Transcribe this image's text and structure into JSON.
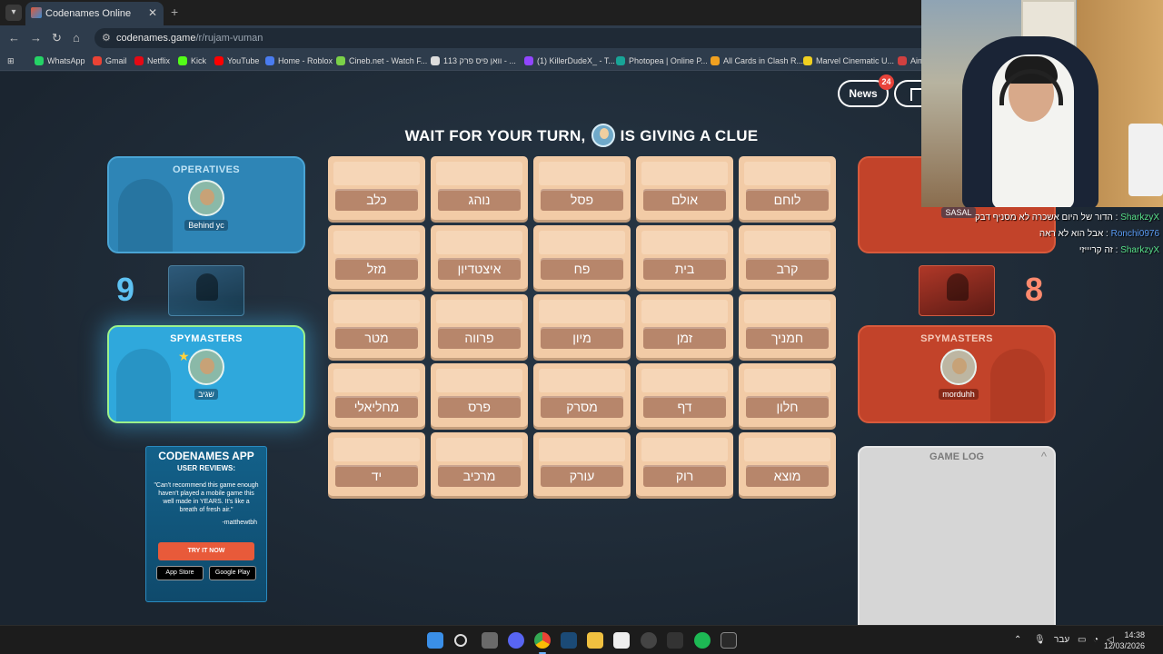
{
  "browser": {
    "tab_title": "Codenames Online",
    "tab_close": "✕",
    "new_tab": "+",
    "url_host": "codenames.game",
    "url_path": "/r/rujam-vuman"
  },
  "bookmarks": [
    {
      "label": "WhatsApp",
      "color": "#25d366"
    },
    {
      "label": "Gmail",
      "color": "#ea4335"
    },
    {
      "label": "Netflix",
      "color": "#e50914"
    },
    {
      "label": "Kick",
      "color": "#53fc18"
    },
    {
      "label": "YouTube",
      "color": "#ff0000"
    },
    {
      "label": "Home - Roblox",
      "color": "#4a7cf0"
    },
    {
      "label": "Cineb.net - Watch F...",
      "color": "#7bd148"
    },
    {
      "label": "וואן פיס פרק 113 - ...",
      "color": "#dddddd"
    },
    {
      "label": "(1) KillerDudeX_ - T...",
      "color": "#9146ff"
    },
    {
      "label": "Photopea | Online P...",
      "color": "#18a497"
    },
    {
      "label": "All Cards in Clash R...",
      "color": "#f0a020"
    },
    {
      "label": "Marvel Cinematic U...",
      "color": "#f0d020"
    },
    {
      "label": "Aim",
      "color": "#d04040"
    }
  ],
  "header": {
    "news_label": "News",
    "news_badge": "24"
  },
  "status": {
    "before": "WAIT FOR YOUR TURN,",
    "after": "IS GIVING A CLUE"
  },
  "blue_team": {
    "operatives_title": "OPERATIVES",
    "operative_name": "Behind yc",
    "score": "9",
    "spymasters_title": "SPYMASTERS",
    "spymaster_name": "שגיב",
    "color": "#2fa8dc"
  },
  "red_team": {
    "operatives_name": "SASAL",
    "score": "8",
    "spymasters_title": "SPYMASTERS",
    "spymaster_name": "morduhh",
    "color": "#c2432a"
  },
  "board": {
    "words": [
      [
        "כלב",
        "נוהג",
        "פסל",
        "אולם",
        "לוחם"
      ],
      [
        "מזל",
        "איצטדיון",
        "פח",
        "בית",
        "קרב"
      ],
      [
        "מטר",
        "פרווה",
        "מיון",
        "זמן",
        "חמניך"
      ],
      [
        "מחליאלי",
        "פרס",
        "מסרק",
        "דף",
        "חלון"
      ],
      [
        "יד",
        "מרכיב",
        "עורק",
        "רוק",
        "מוצא"
      ]
    ]
  },
  "ad": {
    "title": "CODENAMES APP",
    "subtitle": "USER REVIEWS:",
    "quote": "\"Can't recommend this game enough haven't played a mobile game this well made in YEARS. It's like a breath of fresh air.\"",
    "author": "-matthewtbh",
    "cta": "TRY IT NOW",
    "store1": "App Store",
    "store2": "Google Play"
  },
  "game_log": {
    "title": "GAME LOG",
    "toggle": "^"
  },
  "chat": [
    {
      "user": "SharkzyX",
      "text": "הדור של היום אשכרה לא מסניף דבק",
      "color": "green"
    },
    {
      "user": "Ronchi0976",
      "text": "אבל הוא לא ראה",
      "color": "blue"
    },
    {
      "user": "SharkzyX",
      "text": "זה קריייזי",
      "color": "green"
    }
  ],
  "taskbar": {
    "lang": "עבר",
    "time": "14:38",
    "date": "12/03/2026"
  }
}
